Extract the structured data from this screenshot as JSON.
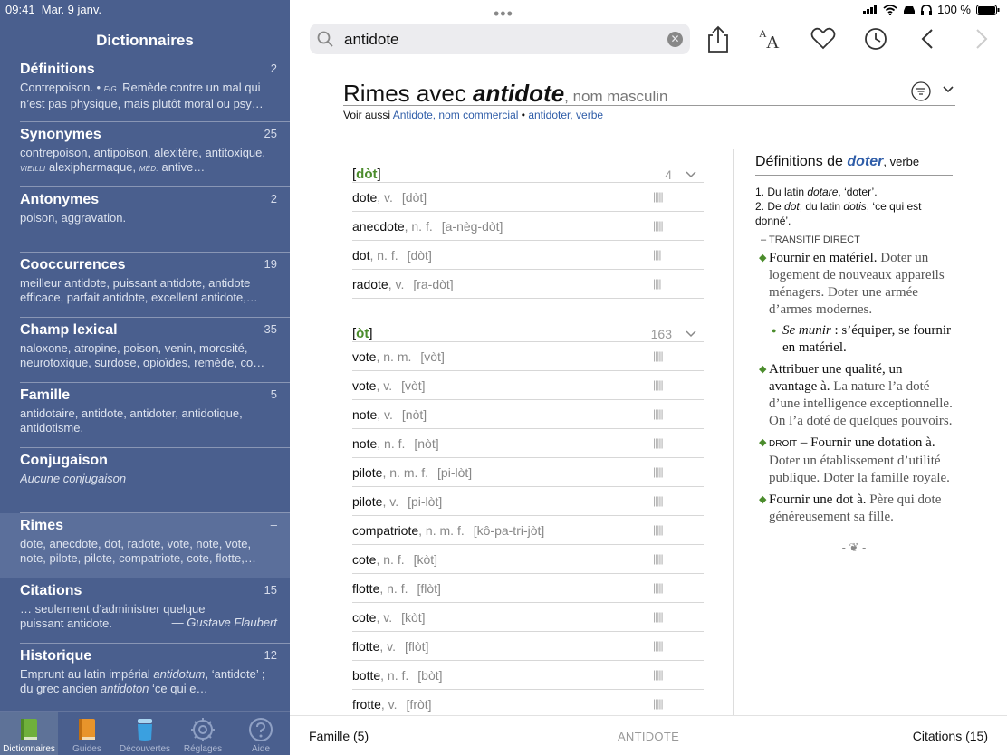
{
  "status": {
    "time": "09:41",
    "date": "Mar. 9 janv.",
    "battery": "100 %"
  },
  "sidebar": {
    "title": "Dictionnaires",
    "items": [
      {
        "name": "Définitions",
        "count": "2",
        "desc_a": "Contrepoison. • ",
        "desc_tag": "FIG.",
        "desc_b": " Remède contre un mal qui n’est pas physique, mais plutôt moral ou psy…"
      },
      {
        "name": "Synonymes",
        "count": "25",
        "desc_a": "contrepoison, antipoison, alexitère, antitoxique, ",
        "desc_tag": "VIEILLI",
        "desc_b": " alexipharmaque, ",
        "desc_tag2": "MÉD.",
        "desc_c": " antive…"
      },
      {
        "name": "Antonymes",
        "count": "2",
        "desc_a": "poison, aggravation."
      },
      {
        "name": "Cooccurrences",
        "count": "19",
        "desc_a": "meilleur antidote, puissant antidote, antidote efficace, parfait antidote, excellent antidote,…"
      },
      {
        "name": "Champ lexical",
        "count": "35",
        "desc_a": "naloxone, atropine, poison, venin, morosité, neurotoxique, surdose, opioïdes, remède, co…"
      },
      {
        "name": "Famille",
        "count": "5",
        "desc_a": "antidotaire, antidote, antidoter, antidotique, antidotisme."
      },
      {
        "name": "Conjugaison",
        "count": "",
        "desc_i": "Aucune conjugaison"
      },
      {
        "name": "Rimes",
        "count": "–",
        "desc_a": "dote, anecdote, dot, radote, vote, note, vote, note, pilote, pilote, compatriote, cote, flotte,…"
      },
      {
        "name": "Citations",
        "count": "15",
        "desc_a": "… seulement d’administrer quelque puissant antidote.",
        "author": "— Gustave Flaubert"
      },
      {
        "name": "Historique",
        "count": "12",
        "desc_a": "Emprunt au latin impérial ",
        "desc_i1": "antidotum",
        "desc_b": ", ‘antidote’ ; du grec ancien ",
        "desc_i2": "antidoton",
        "desc_c": " ‘ce qui e…"
      }
    ]
  },
  "tabs": [
    "Dictionnaires",
    "Guides",
    "Découvertes",
    "Réglages",
    "Aide"
  ],
  "search": {
    "value": "antidote"
  },
  "heading": {
    "prefix": "Rimes avec ",
    "word": "antidote",
    "pos": ", nom masculin"
  },
  "voir": {
    "label": "Voir aussi ",
    "link1": "Antidote, nom commercial",
    "sep": " • ",
    "link2": "antidoter, verbe"
  },
  "groups": [
    {
      "open": "[",
      "rhyme": "dòt",
      "close": "]",
      "count": "4",
      "rows": [
        {
          "word": "dote",
          "cat": ", v.",
          "pho": "[dòt]",
          "syl": "|||||"
        },
        {
          "word": "anecdote",
          "cat": ", n. f.",
          "pho": "[a-nèg-dòt]",
          "syl": "|||||"
        },
        {
          "word": "dot",
          "cat": ", n. f.",
          "pho": "[dòt]",
          "syl": "||||"
        },
        {
          "word": "radote",
          "cat": ", v.",
          "pho": "[ra-dòt]",
          "syl": "||||"
        }
      ]
    },
    {
      "open": "[",
      "rhyme": "òt",
      "close": "]",
      "count": "163",
      "rows": [
        {
          "word": "vote",
          "cat": ", n. m.",
          "pho": "[vòt]",
          "syl": "|||||"
        },
        {
          "word": "vote",
          "cat": ", v.",
          "pho": "[vòt]",
          "syl": "|||||"
        },
        {
          "word": "note",
          "cat": ", v.",
          "pho": "[nòt]",
          "syl": "|||||"
        },
        {
          "word": "note",
          "cat": ", n. f.",
          "pho": "[nòt]",
          "syl": "|||||"
        },
        {
          "word": "pilote",
          "cat": ", n. m. f.",
          "pho": "[pi-lòt]",
          "syl": "|||||"
        },
        {
          "word": "pilote",
          "cat": ", v.",
          "pho": "[pi-lòt]",
          "syl": "|||||"
        },
        {
          "word": "compatriote",
          "cat": ", n. m. f.",
          "pho": "[kô-pa-tri-jòt]",
          "syl": "|||||"
        },
        {
          "word": "cote",
          "cat": ", n. f.",
          "pho": "[kòt]",
          "syl": "|||||"
        },
        {
          "word": "flotte",
          "cat": ", n. f.",
          "pho": "[flòt]",
          "syl": "|||||"
        },
        {
          "word": "cote",
          "cat": ", v.",
          "pho": "[kòt]",
          "syl": "|||||"
        },
        {
          "word": "flotte",
          "cat": ", v.",
          "pho": "[flòt]",
          "syl": "|||||"
        },
        {
          "word": "botte",
          "cat": ", n. f.",
          "pho": "[bòt]",
          "syl": "|||||"
        },
        {
          "word": "frotte",
          "cat": ", v.",
          "pho": "[fròt]",
          "syl": "|||||"
        }
      ]
    }
  ],
  "definition": {
    "title_prefix": "Définitions de ",
    "word": "doter",
    "pos": ", verbe",
    "etym1_a": "1. Du latin ",
    "etym1_i": "dotare",
    "etym1_b": ", ‘doter’.",
    "etym2_a": "2. De ",
    "etym2_i1": "dot",
    "etym2_b": "; du latin ",
    "etym2_i2": "dotis",
    "etym2_c": ", ‘ce qui est donné’.",
    "transitif": "– TRANSITIF DIRECT",
    "s1": "Fournir en matériel.",
    "s1_ex": " Doter un logement de nouveaux appareils ménagers. Doter une armée d’armes modernes.",
    "s1_sub_i": "Se munir",
    "s1_sub": " : s’équiper, se fournir en matériel.",
    "s2": "Attribuer une qualité, un avantage à.",
    "s2_ex": " La nature l’a doté d’une intelligence exceptionnelle. On l’a doté de quelques pouvoirs.",
    "s3_dom": "DROIT",
    "s3": " – Fournir une dotation à.",
    "s3_ex": " Doter un établissement d’utilité publique. Doter la famille royale.",
    "s4": "Fournir une dot à.",
    "s4_ex": " Père qui dote généreusement sa fille.",
    "ornament": "- ❦ -"
  },
  "bottom": {
    "left": "Famille (5)",
    "middle": "ANTIDOTE",
    "right": "Citations (15)"
  }
}
